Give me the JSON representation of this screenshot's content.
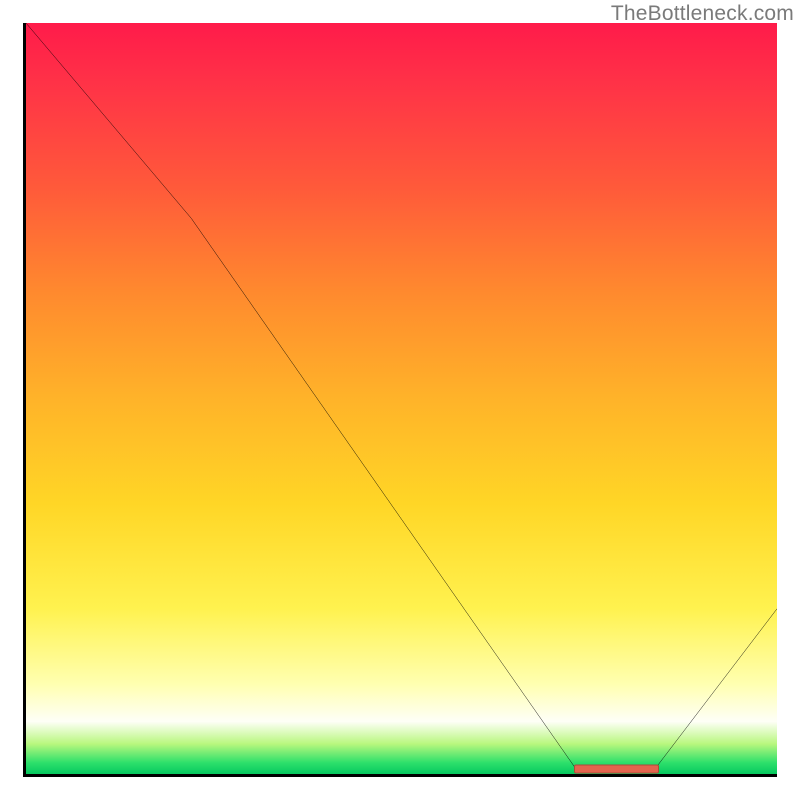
{
  "watermark": "TheBottleneck.com",
  "chart_data": {
    "type": "line",
    "title": "",
    "xlabel": "",
    "ylabel": "",
    "xlim": [
      0,
      100
    ],
    "ylim": [
      0,
      100
    ],
    "grid": false,
    "series": [
      {
        "name": "curve",
        "x": [
          0,
          22,
          73,
          84,
          100
        ],
        "values": [
          100,
          74,
          1,
          1,
          22
        ]
      }
    ],
    "annotations": [
      {
        "name": "highlight-segment",
        "type": "region",
        "x_start": 73,
        "x_end": 84,
        "y": 1
      }
    ],
    "background": "rainbow-vertical"
  }
}
